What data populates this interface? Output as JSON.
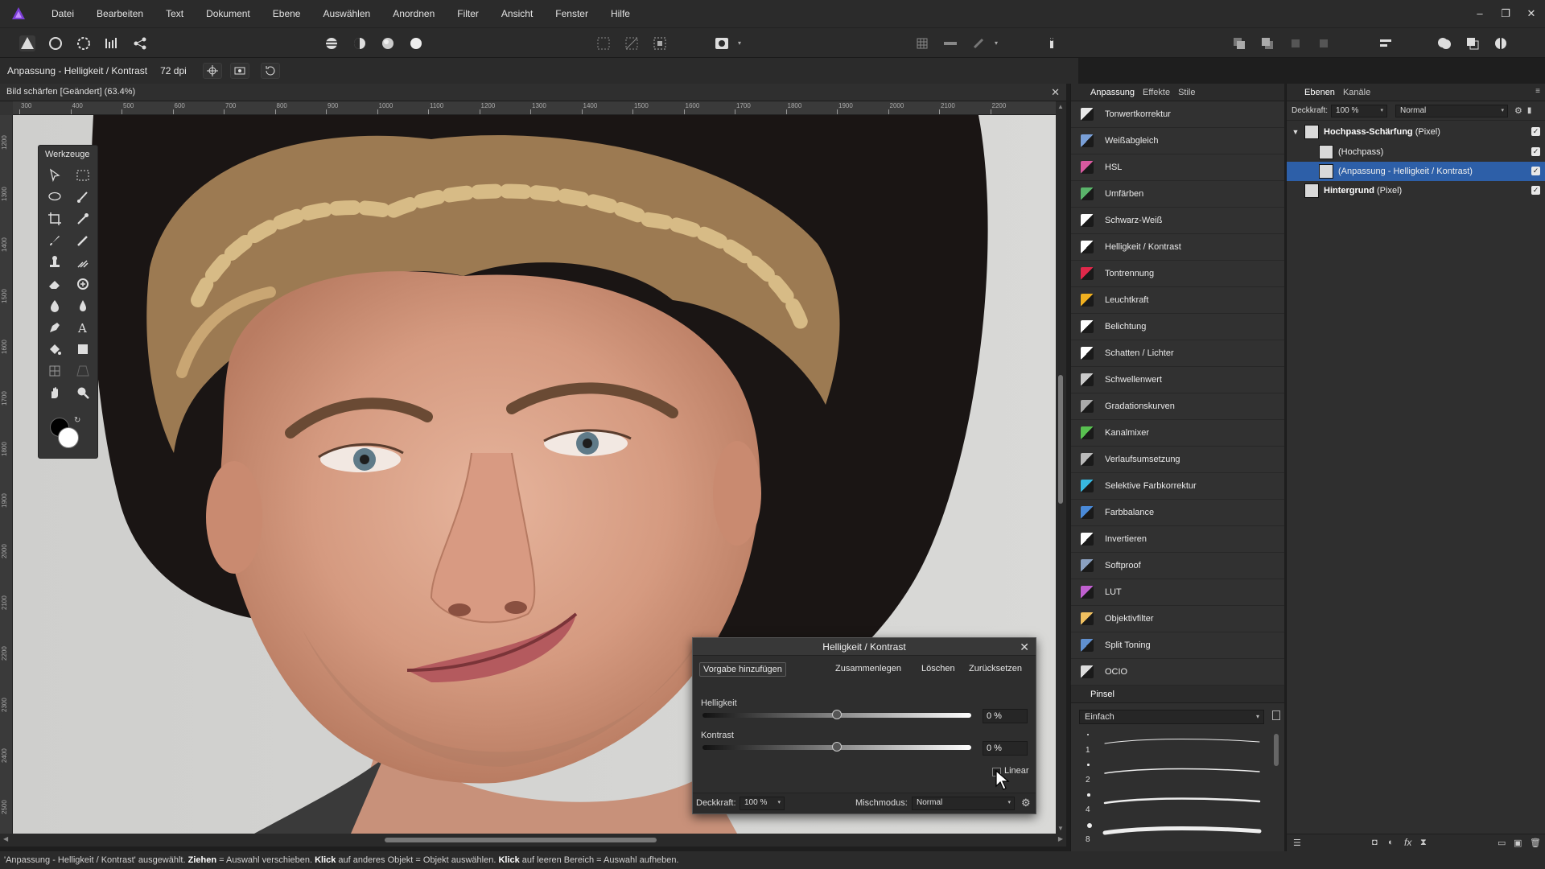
{
  "menubar": {
    "items": [
      "Datei",
      "Bearbeiten",
      "Text",
      "Dokument",
      "Ebene",
      "Auswählen",
      "Anordnen",
      "Filter",
      "Ansicht",
      "Fenster",
      "Hilfe"
    ],
    "window_controls": [
      "–",
      "❐",
      "✕"
    ]
  },
  "context": {
    "title": "Anpassung - Helligkeit / Kontrast",
    "dpi": "72 dpi"
  },
  "document": {
    "tab_title": "Bild schärfen [Geändert] (63.4%)",
    "close": "✕"
  },
  "rulers": {
    "top_labels": [
      "300",
      "400",
      "500",
      "600",
      "700",
      "800",
      "900",
      "1000",
      "1100",
      "1200",
      "1300",
      "1400",
      "1500",
      "1600",
      "1700",
      "1800",
      "1900",
      "2000",
      "2100",
      "2200"
    ],
    "left_labels": [
      "1200",
      "1300",
      "1400",
      "1500",
      "1600",
      "1700",
      "1800",
      "1900",
      "2000",
      "2100",
      "2200",
      "2300",
      "2400",
      "2500"
    ]
  },
  "tools_panel": {
    "title": "Werkzeuge"
  },
  "adjustment_panel": {
    "tabs": [
      "Anpassung",
      "Effekte",
      "Stile"
    ],
    "items": [
      {
        "label": "Tonwertkorrektur",
        "color": "#e8e8e8",
        "icon": "levels-icon"
      },
      {
        "label": "Weißabgleich",
        "color": "#7aa0d8",
        "icon": "white-balance-icon"
      },
      {
        "label": "HSL",
        "color": "#d85aa0",
        "icon": "hsl-icon"
      },
      {
        "label": "Umfärben",
        "color": "#5ab46a",
        "icon": "recolor-icon"
      },
      {
        "label": "Schwarz-Weiß",
        "color": "#ffffff",
        "icon": "black-white-icon"
      },
      {
        "label": "Helligkeit / Kontrast",
        "color": "#ffffff",
        "icon": "brightness-contrast-icon"
      },
      {
        "label": "Tontrennung",
        "color": "#e0284a",
        "icon": "posterize-icon"
      },
      {
        "label": "Leuchtkraft",
        "color": "#f0b020",
        "icon": "vibrance-icon"
      },
      {
        "label": "Belichtung",
        "color": "#ffffff",
        "icon": "exposure-icon"
      },
      {
        "label": "Schatten / Lichter",
        "color": "#ffffff",
        "icon": "shadows-highlights-icon"
      },
      {
        "label": "Schwellenwert",
        "color": "#cccccc",
        "icon": "threshold-icon"
      },
      {
        "label": "Gradationskurven",
        "color": "#aaaaaa",
        "icon": "curves-icon"
      },
      {
        "label": "Kanalmixer",
        "color": "#58c050",
        "icon": "channel-mixer-icon"
      },
      {
        "label": "Verlaufsumsetzung",
        "color": "#bbbbbb",
        "icon": "gradient-map-icon"
      },
      {
        "label": "Selektive Farbkorrektur",
        "color": "#38b8e0",
        "icon": "selective-color-icon"
      },
      {
        "label": "Farbbalance",
        "color": "#4a8ad8",
        "icon": "color-balance-icon"
      },
      {
        "label": "Invertieren",
        "color": "#ffffff",
        "icon": "invert-icon"
      },
      {
        "label": "Softproof",
        "color": "#8aa0c0",
        "icon": "soft-proof-icon"
      },
      {
        "label": "LUT",
        "color": "#c060d0",
        "icon": "lut-icon"
      },
      {
        "label": "Objektivfilter",
        "color": "#f0c060",
        "icon": "lens-filter-icon"
      },
      {
        "label": "Split Toning",
        "color": "#6090d0",
        "icon": "split-toning-icon"
      },
      {
        "label": "OCIO",
        "color": "#dddddd",
        "icon": "ocio-icon"
      }
    ]
  },
  "brush_panel": {
    "tab": "Pinsel",
    "category": "Einfach",
    "brushes": [
      {
        "size": "1",
        "stroke_width": 1
      },
      {
        "size": "2",
        "stroke_width": 1.5
      },
      {
        "size": "4",
        "stroke_width": 2.5
      },
      {
        "size": "8",
        "stroke_width": 5
      }
    ]
  },
  "layers_panel": {
    "tabs": [
      "Ebenen",
      "Kanäle"
    ],
    "opacity_label": "Deckkraft:",
    "opacity_value": "100 %",
    "blend_mode": "Normal",
    "layers": [
      {
        "name": "Hochpass-Schärfung",
        "type": "(Pixel)",
        "indent": 0,
        "selected": false,
        "expanded": true,
        "checked": true
      },
      {
        "name": "",
        "type": "(Hochpass)",
        "indent": 1,
        "selected": false,
        "expanded": false,
        "checked": true
      },
      {
        "name": "",
        "type": "(Anpassung - Helligkeit / Kontrast)",
        "indent": 1,
        "selected": true,
        "expanded": false,
        "checked": true
      },
      {
        "name": "Hintergrund",
        "type": "(Pixel)",
        "indent": 0,
        "selected": false,
        "expanded": false,
        "checked": true
      }
    ]
  },
  "dialog": {
    "title": "Helligkeit / Kontrast",
    "close": "✕",
    "buttons": {
      "preset": "Vorgabe hinzufügen",
      "merge": "Zusammenlegen",
      "delete": "Löschen",
      "reset": "Zurücksetzen"
    },
    "brightness_label": "Helligkeit",
    "brightness_value": "0 %",
    "brightness_level": 0.5,
    "contrast_label": "Kontrast",
    "contrast_value": "0 %",
    "contrast_level": 0.5,
    "linear_label": "Linear",
    "linear_checked": false,
    "opacity_label": "Deckkraft:",
    "opacity_value": "100 %",
    "blend_label": "Mischmodus:",
    "blend_value": "Normal"
  },
  "status": {
    "t1": "'Anpassung - Helligkeit / Kontrast' ausgewählt. ",
    "b1": "Ziehen",
    "t2": " = Auswahl verschieben. ",
    "b2": "Klick",
    "t3": " auf anderes Objekt = Objekt auswählen. ",
    "b3": "Klick",
    "t4": " auf leeren Bereich = Auswahl aufheben."
  }
}
